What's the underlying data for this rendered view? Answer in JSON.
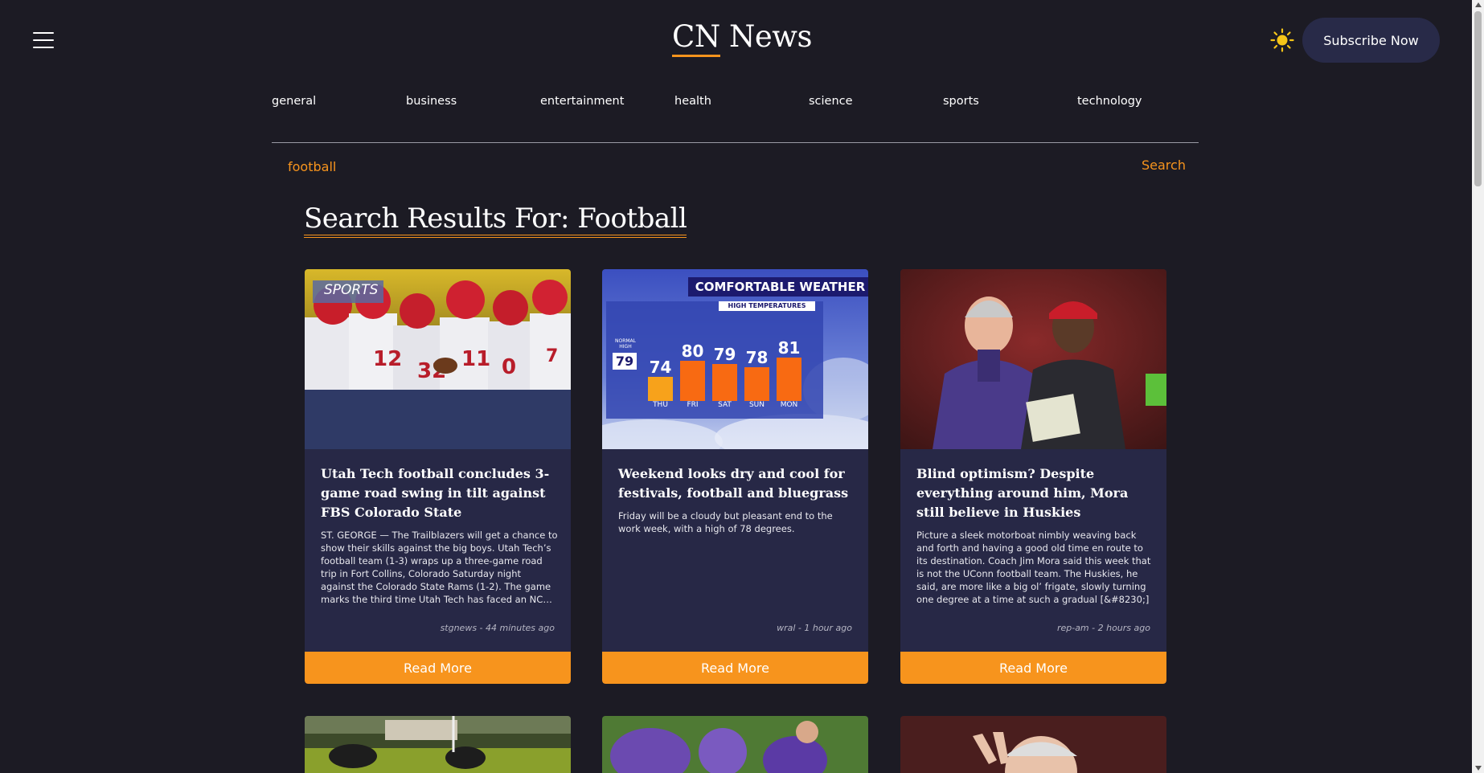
{
  "header": {
    "logo_cn": "CN",
    "logo_news": "News",
    "subscribe_label": "Subscribe Now",
    "theme_icon": "sun-icon",
    "menu_icon": "hamburger-menu-icon"
  },
  "nav": {
    "items": [
      "general",
      "business",
      "entertainment",
      "health",
      "science",
      "sports",
      "technology"
    ]
  },
  "search": {
    "value": "football",
    "button_label": "Search"
  },
  "results": {
    "title": "Search Results For: Football"
  },
  "colors": {
    "accent": "#f7941d",
    "background": "#1c1b24",
    "card": "#272846",
    "subscribe_bg": "#282a48"
  },
  "cards": [
    {
      "title": "Utah Tech football concludes 3-game road swing in tilt against FBS Colorado State",
      "description": "ST. GEORGE — The Trailblazers will get a chance to show their skills against the big boys. Utah Tech’s football team (1-3) wraps up a three-game road trip in Fort Collins, Colorado Saturday night against the Colorado State Rams (1-2). The game marks the third time Utah Tech has faced an NCAA Division I Football Bowl Subdivision",
      "meta": "stgnews - 44 minutes ago",
      "read_more": "Read More",
      "image_badge": "SPORTS"
    },
    {
      "title": "Weekend looks dry and cool for festivals, football and bluegrass",
      "description": "Friday will be a cloudy but pleasant end to the work week, with a high of 78 degrees.",
      "meta": "wral - 1 hour ago",
      "read_more": "Read More",
      "weather": {
        "banner": "COMFORTABLE WEATHER",
        "subtitle": "HIGH TEMPERATURES",
        "normal_label_1": "NORMAL",
        "normal_label_2": "HIGH",
        "normal_value": "79",
        "days": [
          "THU",
          "FRI",
          "SAT",
          "SUN",
          "MON"
        ],
        "temps": [
          "74",
          "80",
          "79",
          "78",
          "81"
        ]
      }
    },
    {
      "title": "Blind optimism? Despite everything around him, Mora still believe in Huskies",
      "description": "Picture a sleek motorboat nimbly weaving back and forth and having a good old time en route to its destination. Coach Jim Mora said this week that is not the UConn football team. The Huskies, he said, are more like a big ol’ frigate, slowly turning one degree at a time at such a gradual [&#8230;]",
      "meta": "rep-am - 2 hours ago",
      "read_more": "Read More"
    }
  ]
}
